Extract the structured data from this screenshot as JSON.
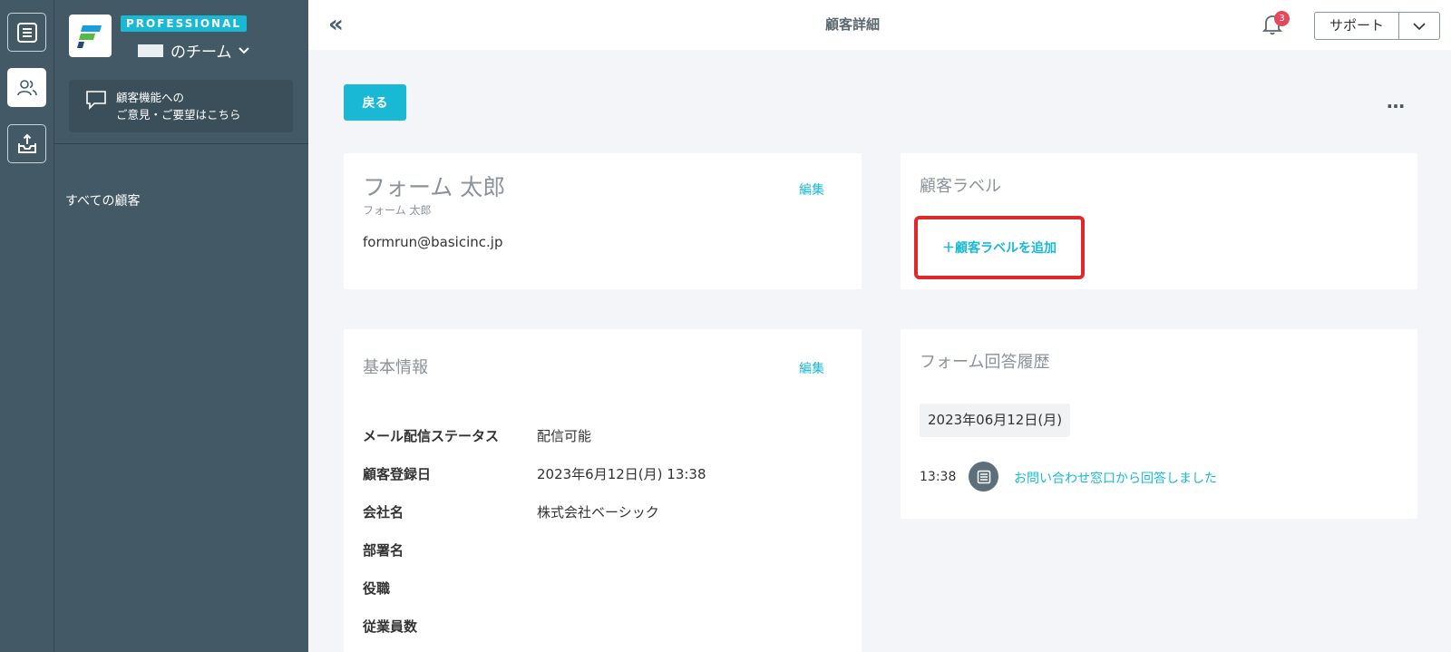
{
  "sidebar": {
    "plan_badge": "PROFESSIONAL",
    "team_name": "のチーム",
    "feedback": {
      "line1": "顧客機能への",
      "line2": "ご意見・ご要望はこちら"
    },
    "nav_all_customers": "すべての顧客",
    "rail_icons": [
      "form-list-icon",
      "customers-icon",
      "inbox-icon"
    ]
  },
  "header": {
    "title": "顧客詳細",
    "notification_count": "3",
    "support_label": "サポート"
  },
  "toolbar": {
    "back_label": "戻る",
    "more_label": "…"
  },
  "customer": {
    "name": "フォーム 太郎",
    "name_kana": "フォーム 太郎",
    "email": "formrun@basicinc.jp",
    "edit_label": "編集"
  },
  "labels_card": {
    "heading": "顧客ラベル",
    "add_label": "＋顧客ラベルを追加"
  },
  "basic_info": {
    "heading": "基本情報",
    "edit_label": "編集",
    "rows": [
      {
        "key": "メール配信ステータス",
        "value": "配信可能"
      },
      {
        "key": "顧客登録日",
        "value": "2023年6月12日(月) 13:38"
      },
      {
        "key": "会社名",
        "value": "株式会社ベーシック"
      },
      {
        "key": "部署名",
        "value": ""
      },
      {
        "key": "役職",
        "value": ""
      },
      {
        "key": "従業員数",
        "value": ""
      }
    ]
  },
  "history": {
    "heading": "フォーム回答履歴",
    "date": "2023年06月12日(月)",
    "entries": [
      {
        "time": "13:38",
        "text": "お問い合わせ窓口から回答しました"
      }
    ]
  },
  "colors": {
    "accent": "#19b9d6",
    "sidebar": "#435a66",
    "highlight": "#e02828",
    "badge": "#e5485b"
  }
}
